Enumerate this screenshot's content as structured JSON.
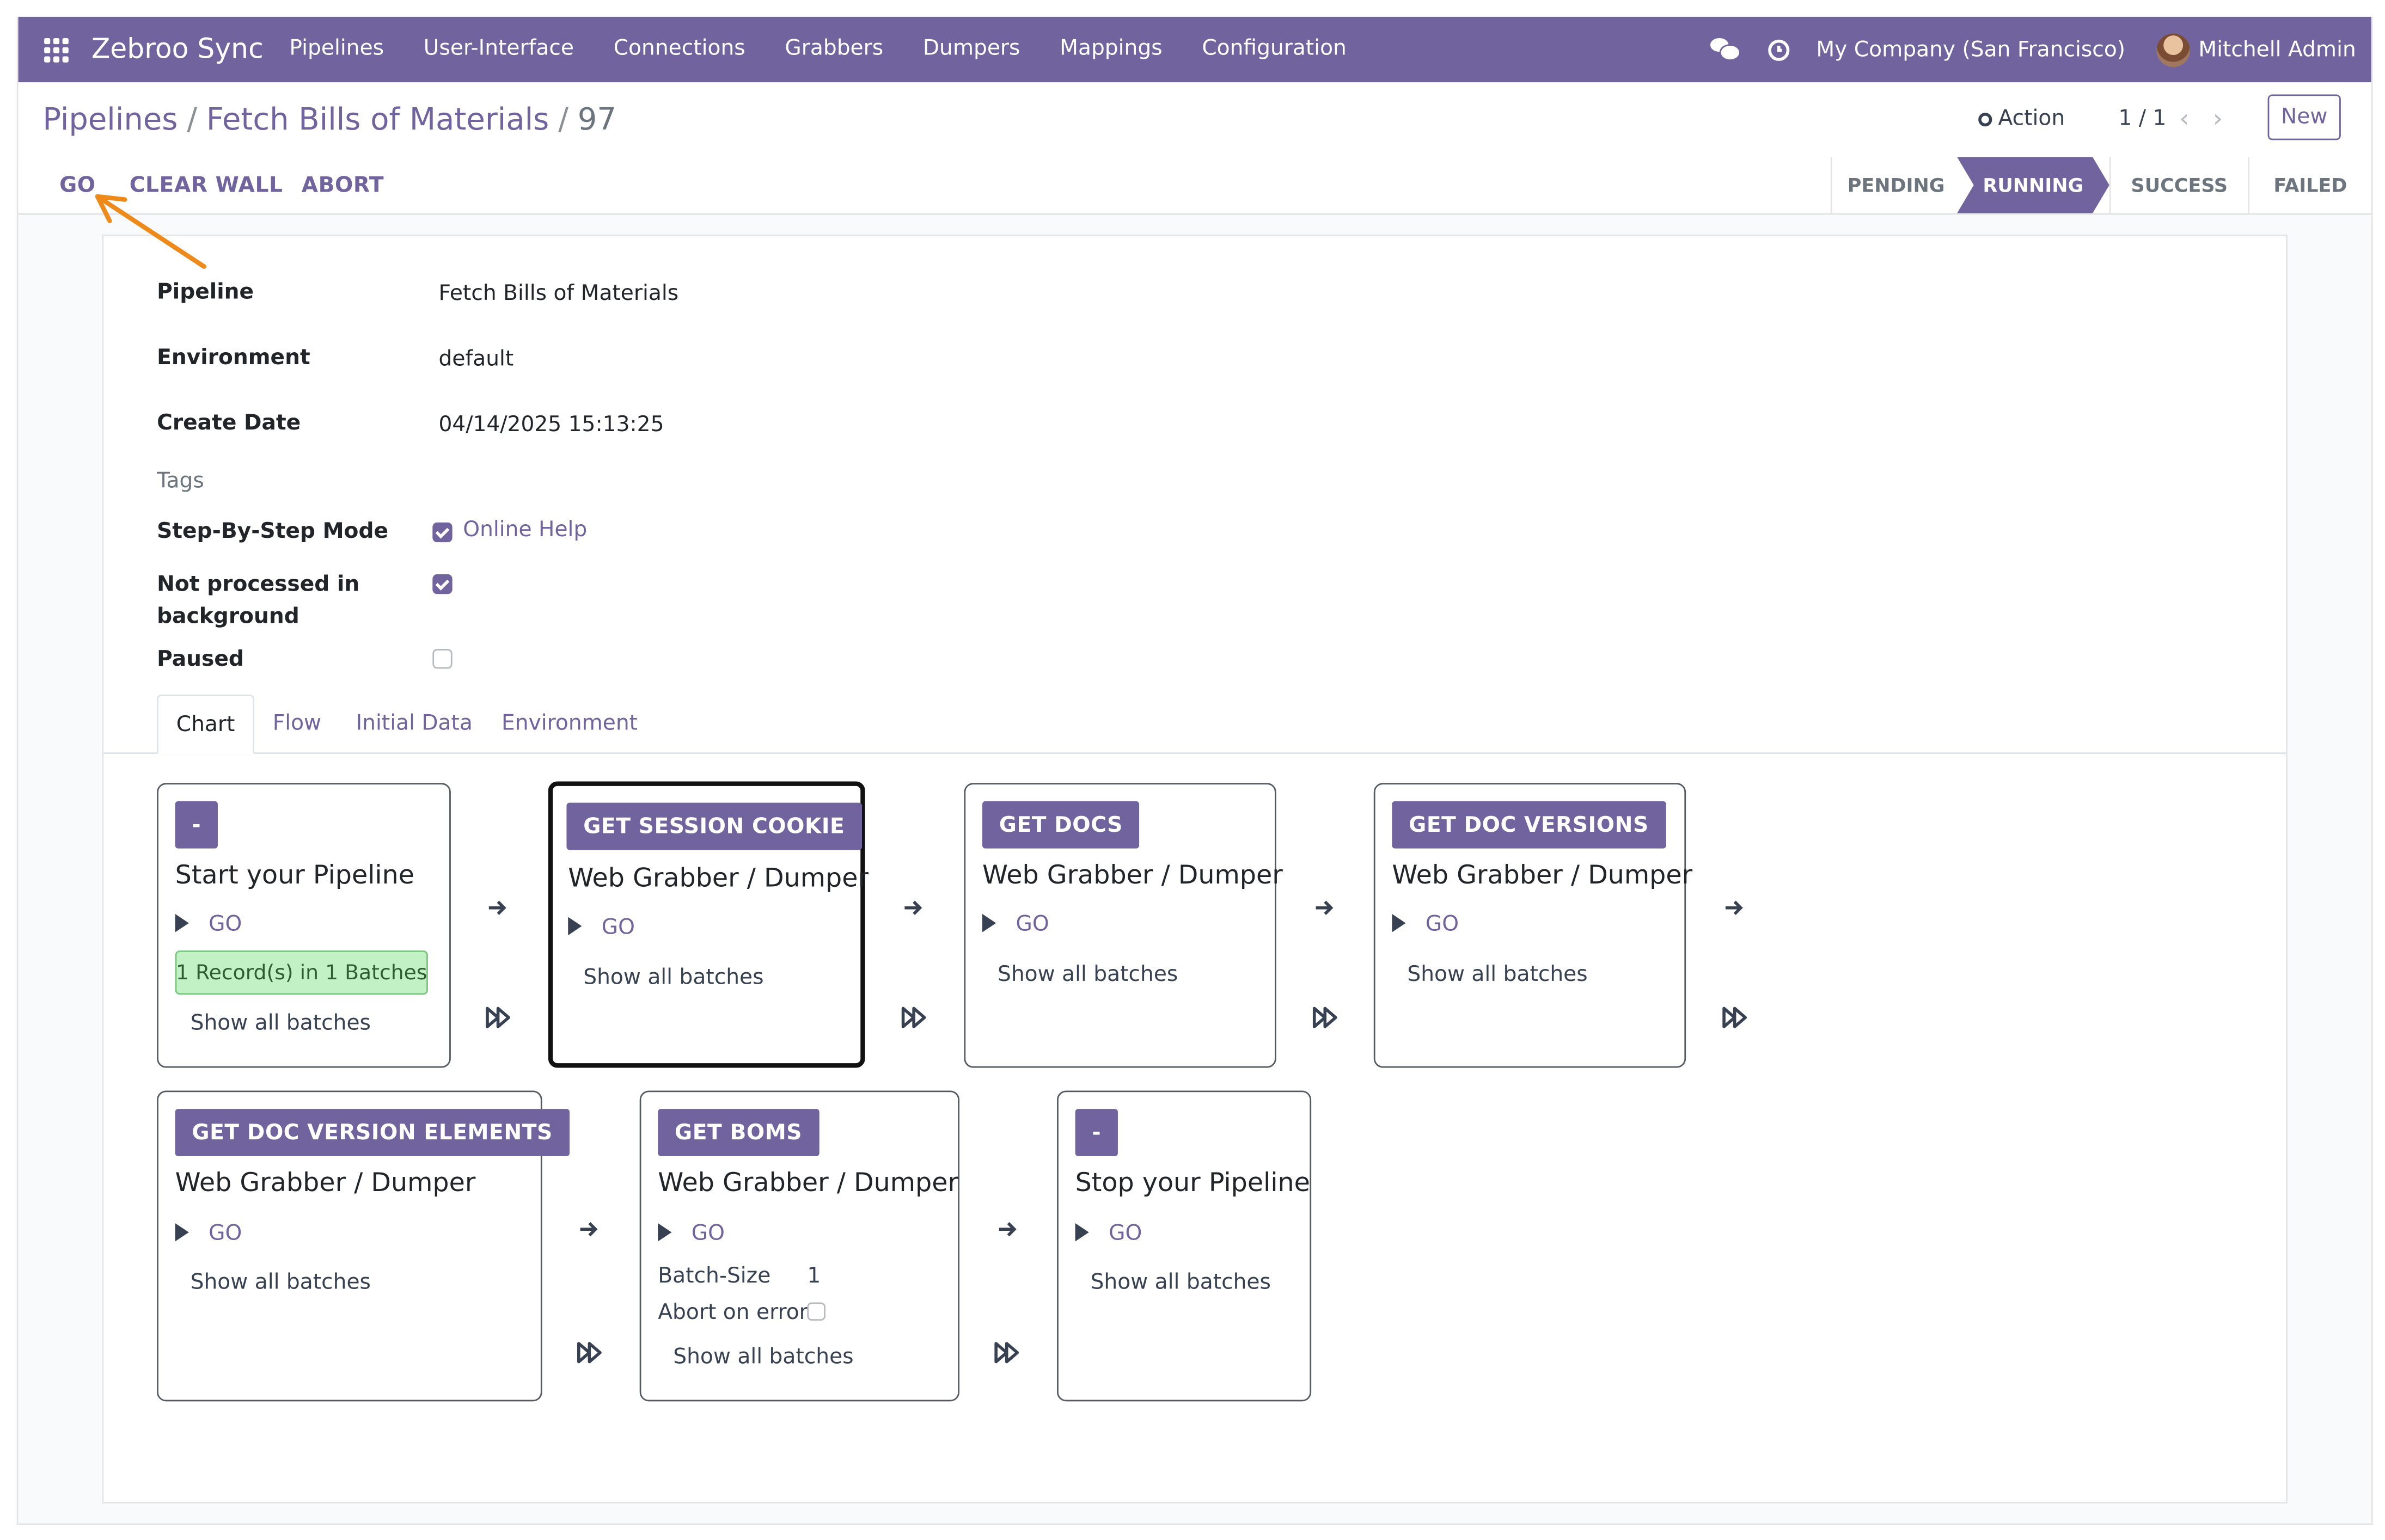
{
  "navbar": {
    "brand": "Zebroo Sync",
    "menu": [
      "Pipelines",
      "User-Interface",
      "Connections",
      "Grabbers",
      "Dumpers",
      "Mappings",
      "Configuration"
    ],
    "company": "My Company (San Francisco)",
    "user": "Mitchell Admin",
    "accent_color": "#71639e"
  },
  "breadcrumb": {
    "root": "Pipelines",
    "parent": "Fetch Bills of Materials",
    "current": "97",
    "separator": "/"
  },
  "control_panel": {
    "action_label": "Action",
    "pager": "1 / 1",
    "new_label": "New"
  },
  "statusbar": {
    "buttons": [
      "GO",
      "CLEAR WALL",
      "ABORT"
    ],
    "stages": [
      "PENDING",
      "RUNNING",
      "SUCCESS",
      "FAILED"
    ],
    "active_stage": "RUNNING"
  },
  "form": {
    "pipeline_label": "Pipeline",
    "pipeline_value": "Fetch Bills of Materials",
    "environment_label": "Environment",
    "environment_value": "default",
    "create_date_label": "Create Date",
    "create_date_value": "04/14/2025 15:13:25",
    "tags_label": "Tags",
    "step_mode_label": "Step-By-Step Mode",
    "step_mode_checked": true,
    "online_help": "Online Help",
    "not_processed_label": "Not processed in background",
    "not_processed_checked": true,
    "paused_label": "Paused",
    "paused_checked": false
  },
  "tabs": [
    "Chart",
    "Flow",
    "Initial Data",
    "Environment"
  ],
  "chart": {
    "go_label": "GO",
    "show_batches_label": "Show all batches",
    "cards": [
      {
        "badge": "-",
        "title": "Start your Pipeline",
        "records": "1 Record(s) in 1 Batches"
      },
      {
        "badge": "GET SESSION COOKIE",
        "title": "Web Grabber / Dumper"
      },
      {
        "badge": "GET DOCS",
        "title": "Web Grabber / Dumper"
      },
      {
        "badge": "GET DOC VERSIONS",
        "title": "Web Grabber / Dumper"
      },
      {
        "badge": "GET DOC VERSION ELEMENTS",
        "title": "Web Grabber / Dumper"
      },
      {
        "badge": "GET BOMS",
        "title": "Web Grabber / Dumper",
        "batch_size_label": "Batch-Size",
        "batch_size_value": "1",
        "abort_label": "Abort on error"
      },
      {
        "badge": "-",
        "title": "Stop your Pipeline"
      }
    ]
  }
}
